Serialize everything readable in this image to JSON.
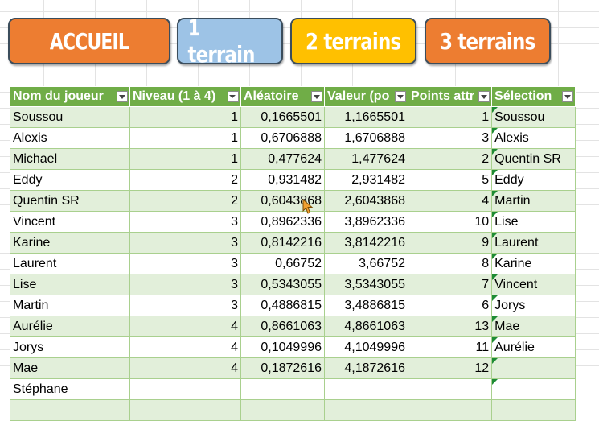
{
  "buttons": {
    "accueil": "ACCUEIL",
    "one": "1 terrain",
    "two": "2 terrains",
    "three": "3 terrains"
  },
  "colors": {
    "accueil": "#ed7d31",
    "one": "#9dc3e6",
    "two": "#ffc000",
    "three": "#ed7d31",
    "header": "#70ad47",
    "band": "#e2efda"
  },
  "table": {
    "headers": [
      "Nom du joueur",
      "Niveau (1 à 4)",
      "Aléatoire",
      "Valeur (po",
      "Points attr",
      "Sélection"
    ],
    "rows": [
      [
        "Soussou",
        "1",
        "0,1665501",
        "1,1665501",
        "1",
        "Soussou"
      ],
      [
        "Alexis",
        "1",
        "0,6706888",
        "1,6706888",
        "3",
        "Alexis"
      ],
      [
        "Michael",
        "1",
        "0,477624",
        "1,477624",
        "2",
        "Quentin SR"
      ],
      [
        "Eddy",
        "2",
        "0,931482",
        "2,931482",
        "5",
        "Eddy"
      ],
      [
        "Quentin SR",
        "2",
        "0,6043868",
        "2,6043868",
        "4",
        "Martin"
      ],
      [
        "Vincent",
        "3",
        "0,8962336",
        "3,8962336",
        "10",
        "Lise"
      ],
      [
        "Karine",
        "3",
        "0,8142216",
        "3,8142216",
        "9",
        "Laurent"
      ],
      [
        "Laurent",
        "3",
        "0,66752",
        "3,66752",
        "8",
        "Karine"
      ],
      [
        "Lise",
        "3",
        "0,5343055",
        "3,5343055",
        "7",
        "Vincent"
      ],
      [
        "Martin",
        "3",
        "0,4886815",
        "3,4886815",
        "6",
        "Jorys"
      ],
      [
        "Aurélie",
        "4",
        "0,8661063",
        "4,8661063",
        "13",
        "Mae"
      ],
      [
        "Jorys",
        "4",
        "0,1049996",
        "4,1049996",
        "11",
        "Aurélie"
      ],
      [
        "Mae",
        "4",
        "0,1872616",
        "4,1872616",
        "12",
        ""
      ],
      [
        "Stéphane",
        "",
        "",
        "",
        "",
        ""
      ],
      [
        "",
        "",
        "",
        "",
        "",
        ""
      ]
    ]
  }
}
